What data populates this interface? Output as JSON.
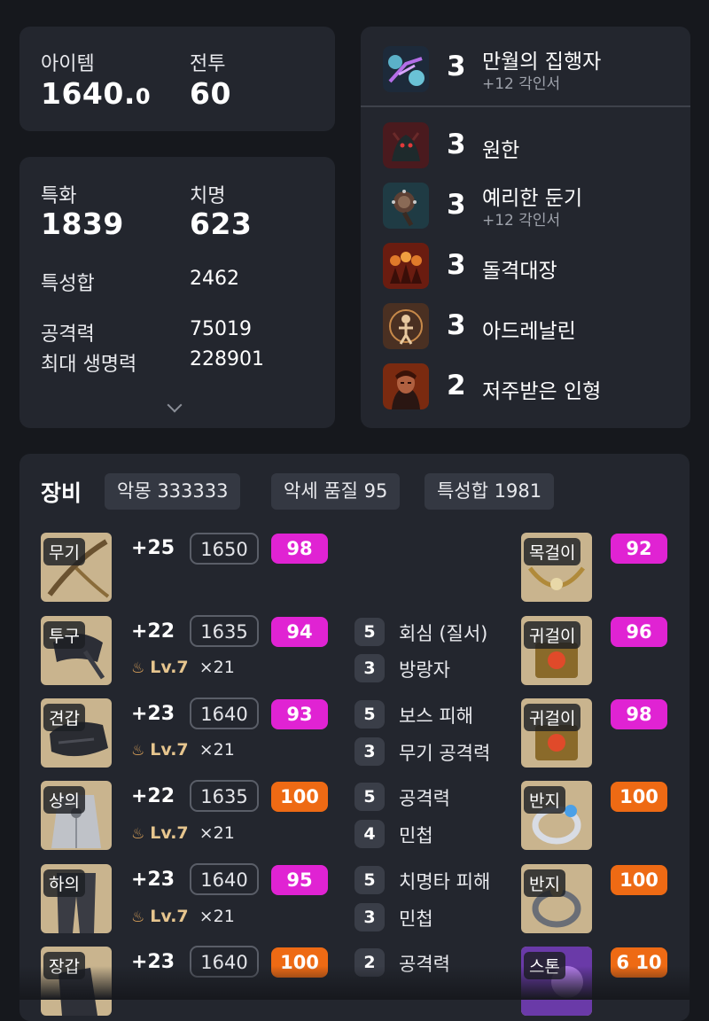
{
  "summary": {
    "item_label": "아이템",
    "item_value": "1640.",
    "item_decimal": "0",
    "combat_label": "전투",
    "combat_value": "60"
  },
  "stats": {
    "spec_label": "특화",
    "spec_value": "1839",
    "crit_label": "치명",
    "crit_value": "623",
    "total_label": "특성합",
    "total_value": "2462",
    "atk_label": "공격력",
    "atk_value": "75019",
    "hp_label": "최대 생명력",
    "hp_value": "228901"
  },
  "engravings": [
    {
      "level": "3",
      "name": "만월의 집행자",
      "sub": "+12 각인서",
      "icon": "engraving-moon-icon"
    },
    {
      "level": "3",
      "name": "원한",
      "sub": "",
      "icon": "engraving-grudge-icon"
    },
    {
      "level": "3",
      "name": "예리한 둔기",
      "sub": "+12 각인서",
      "icon": "engraving-blunt-icon"
    },
    {
      "level": "3",
      "name": "돌격대장",
      "sub": "",
      "icon": "engraving-raid-captain-icon"
    },
    {
      "level": "3",
      "name": "아드레날린",
      "sub": "",
      "icon": "engraving-adrenaline-icon"
    },
    {
      "level": "2",
      "name": "저주받은 인형",
      "sub": "",
      "icon": "engraving-cursed-doll-icon"
    }
  ],
  "equipment": {
    "title": "장비",
    "chips": [
      "악몽 333333",
      "악세 품질 95",
      "특성합 1981"
    ],
    "gear": [
      {
        "slot": "무기",
        "hone": "+25",
        "ilvl": "1650",
        "quality": "98",
        "qcolor": "pink",
        "elixir_lv": "",
        "elixir_count": ""
      },
      {
        "slot": "투구",
        "hone": "+22",
        "ilvl": "1635",
        "quality": "94",
        "qcolor": "pink",
        "elixir_lv": "Lv.7",
        "elixir_count": "×21"
      },
      {
        "slot": "견갑",
        "hone": "+23",
        "ilvl": "1640",
        "quality": "93",
        "qcolor": "pink",
        "elixir_lv": "Lv.7",
        "elixir_count": "×21"
      },
      {
        "slot": "상의",
        "hone": "+22",
        "ilvl": "1635",
        "quality": "100",
        "qcolor": "orange",
        "elixir_lv": "Lv.7",
        "elixir_count": "×21"
      },
      {
        "slot": "하의",
        "hone": "+23",
        "ilvl": "1640",
        "quality": "95",
        "qcolor": "pink",
        "elixir_lv": "Lv.7",
        "elixir_count": "×21"
      },
      {
        "slot": "장갑",
        "hone": "+23",
        "ilvl": "1640",
        "quality": "100",
        "qcolor": "orange",
        "elixir_lv": "",
        "elixir_count": ""
      }
    ],
    "stone_effects": [
      {
        "num": "5",
        "name": "회심 (질서)"
      },
      {
        "num": "3",
        "name": "방랑자"
      },
      {
        "num": "5",
        "name": "보스 피해"
      },
      {
        "num": "3",
        "name": "무기 공격력"
      },
      {
        "num": "5",
        "name": "공격력"
      },
      {
        "num": "4",
        "name": "민첩"
      },
      {
        "num": "5",
        "name": "치명타 피해"
      },
      {
        "num": "3",
        "name": "민첩"
      },
      {
        "num": "2",
        "name": "공격력"
      }
    ],
    "accessories": [
      {
        "slot": "목걸이",
        "quality": "92",
        "qcolor": "pink"
      },
      {
        "slot": "귀걸이",
        "quality": "96",
        "qcolor": "pink"
      },
      {
        "slot": "귀걸이",
        "quality": "98",
        "qcolor": "pink"
      },
      {
        "slot": "반지",
        "quality": "100",
        "qcolor": "orange"
      },
      {
        "slot": "반지",
        "quality": "100",
        "qcolor": "orange"
      },
      {
        "slot": "스톤",
        "quality": "6 10",
        "qcolor": "orange"
      }
    ]
  },
  "colors": {
    "quality_pink": "#e023d3",
    "quality_orange": "#ee6a14",
    "card_bg": "#23262e",
    "page_bg": "#16181d"
  }
}
